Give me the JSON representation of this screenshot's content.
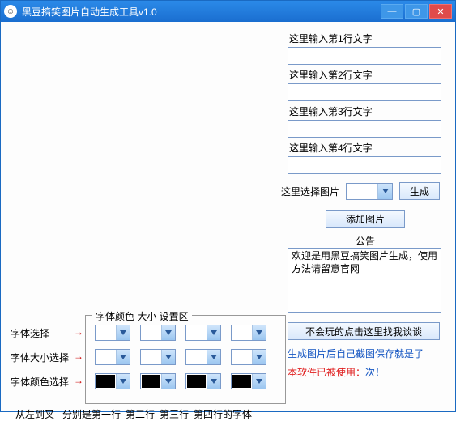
{
  "window": {
    "title": "黑豆搞笑图片自动生成工具v1.0"
  },
  "inputs": {
    "line1_label": "这里输入第1行文字",
    "line2_label": "这里输入第2行文字",
    "line3_label": "这里输入第3行文字",
    "line4_label": "这里输入第4行文字",
    "line1_value": "",
    "line2_value": "",
    "line3_value": "",
    "line4_value": ""
  },
  "image": {
    "select_label": "这里选择图片",
    "generate_btn": "生成",
    "add_btn": "添加图片"
  },
  "notice": {
    "title": "公告",
    "body": "欢迎是用黑豆搞笑图片生成，使用方法请留意官网"
  },
  "help": {
    "button": "不会玩的点击这里找我谈谈",
    "tip": "生成图片后自己截图保存就是了",
    "usage_prefix": "本软件已被使用：",
    "usage_suffix": "次！"
  },
  "font_area": {
    "legend": "字体颜色 大小 设置区",
    "font_select_label": "字体选择",
    "font_size_label": "字体大小选择",
    "font_color_label": "字体颜色选择",
    "arrow": "→",
    "footer_left": "从左到叉",
    "footer_parts": [
      "分别是第一行",
      "第二行",
      "第三行",
      "第四行的字体"
    ]
  }
}
